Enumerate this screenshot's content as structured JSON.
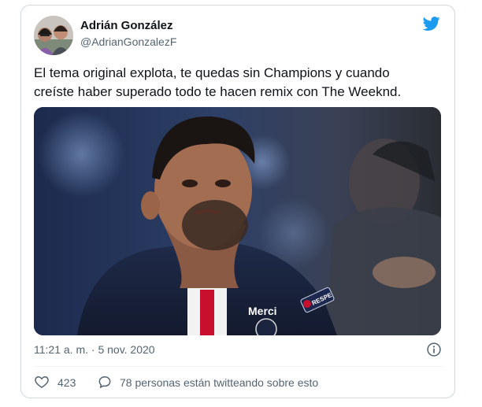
{
  "author": {
    "display_name": "Adrián González",
    "handle": "@AdrianGonzalezF"
  },
  "tweet": {
    "lines": [
      "El tema original explota, te quedas sin Champions y cuando",
      "creíste haber superado todo te hacen remix con The Weeknd."
    ],
    "timestamp": "11:21 a. m. · 5 nov. 2020"
  },
  "photo": {
    "shirt_sponsor": "Merci",
    "sleeve_patch": "RESPE"
  },
  "engagement": {
    "likes": "423",
    "conversation": "78 personas están twitteando sobre esto"
  },
  "colors": {
    "twitter_blue": "#1d9bf0",
    "secondary_text": "#536471",
    "border": "#cfd9de"
  },
  "icons": [
    "twitter-bird-icon",
    "info-icon",
    "heart-icon",
    "reply-icon"
  ]
}
